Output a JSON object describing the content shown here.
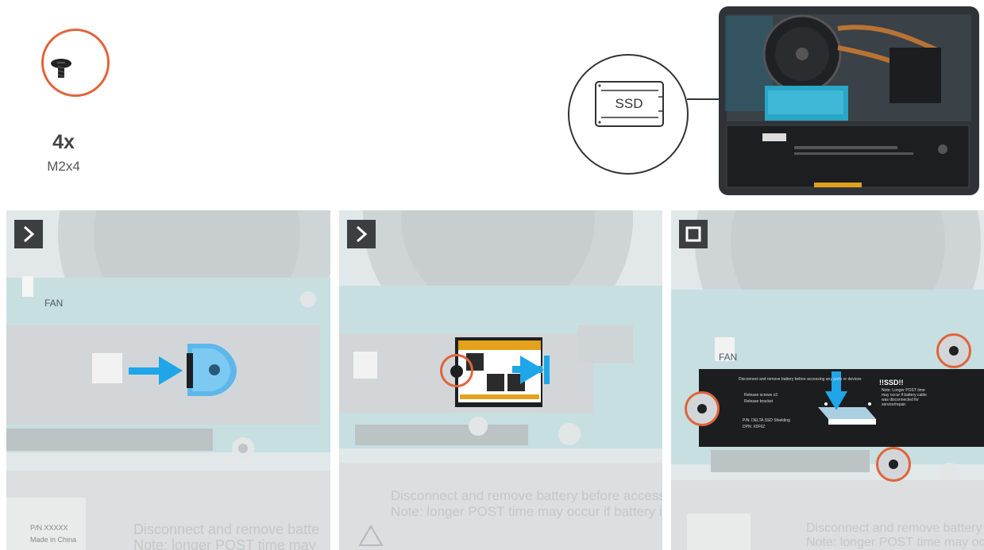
{
  "legend": {
    "screw_count": "4x",
    "screw_size": "M2x4"
  },
  "callout": {
    "label": "SSD"
  },
  "panels": [
    {
      "step": "next",
      "labels": {
        "fan": "FAN"
      },
      "bg_lines": [
        "Disconnect and remove batte",
        "Note: longer POST time may"
      ],
      "tag": [
        "P/N XXXXX",
        "Made in China"
      ]
    },
    {
      "step": "next",
      "bg_lines": [
        "Disconnect and remove battery before accessing",
        "Note: longer POST time may occur if battery is dis"
      ]
    },
    {
      "step": "done",
      "labels": {
        "fan": "FAN"
      },
      "shield": {
        "title": "!!SSD!!",
        "warning": "Disconnect and remove battery before accessing any parts or devices",
        "bullets": [
          "Release screws x3",
          "Release bracket"
        ],
        "pn": "P/N: DELTA SSD Shielding",
        "dpn": "DPN: X0F6Z",
        "note": "Note: Longer POST time may occur if battery cable was disconnected for service/repair."
      },
      "bg_lines": [
        "Disconnect and remove battery be",
        "Note: longer POST time may occu"
      ]
    }
  ],
  "colors": {
    "accent": "#e0643a",
    "arrow": "#1ea6e8",
    "badge": "#3c3f42"
  }
}
